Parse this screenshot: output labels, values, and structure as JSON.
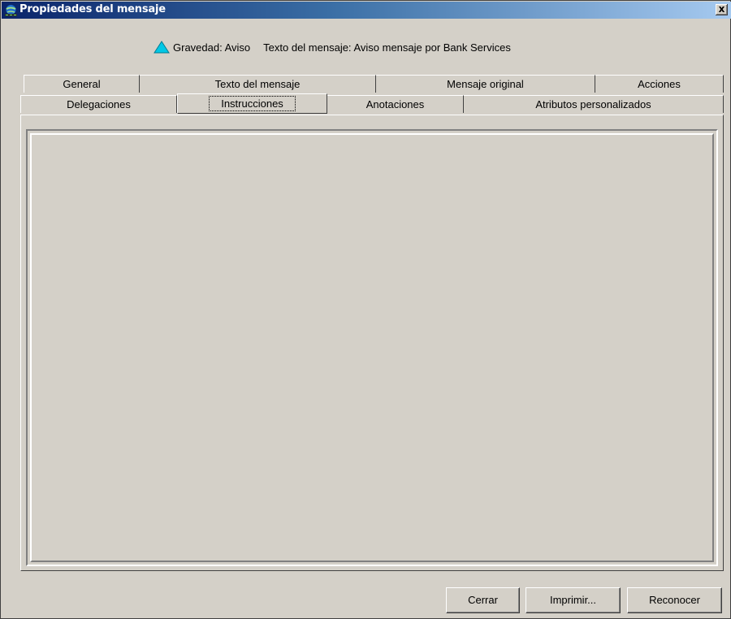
{
  "window": {
    "title": "Propiedades del mensaje",
    "close_label": "x"
  },
  "info": {
    "severity": "Gravedad: Aviso",
    "message": "Texto del mensaje: Aviso mensaje por Bank Services",
    "severity_icon": "warning-triangle-icon",
    "severity_color": "#00c8e6"
  },
  "tabs": {
    "row1": [
      {
        "label": "General"
      },
      {
        "label": "Texto del mensaje"
      },
      {
        "label": "Mensaje original"
      },
      {
        "label": "Acciones"
      }
    ],
    "row2": [
      {
        "label": "Delegaciones"
      },
      {
        "label": "Instrucciones"
      },
      {
        "label": "Anotaciones"
      },
      {
        "label": "Atributos personalizados"
      }
    ],
    "active": "Instrucciones"
  },
  "buttons": {
    "close": "Cerrar",
    "print": "Imprimir...",
    "acknowledge": "Reconocer"
  },
  "colors": {
    "title_start": "#0a246a",
    "title_end": "#a6caf0",
    "face": "#d4d0c8"
  }
}
